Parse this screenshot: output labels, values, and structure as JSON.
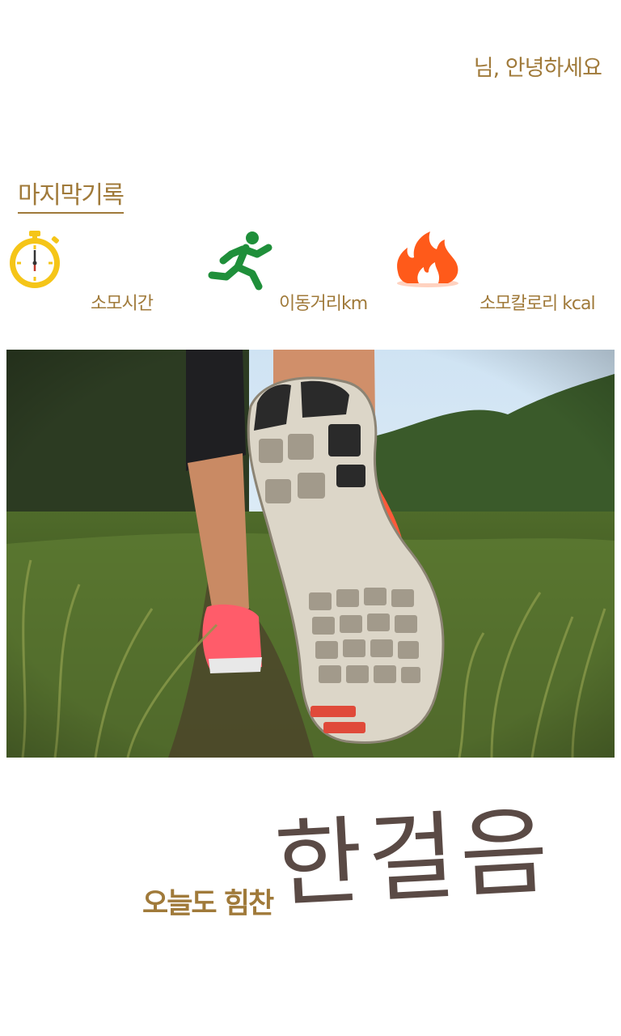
{
  "header": {
    "greeting": "님, 안녕하세요"
  },
  "last_record": {
    "title": "마지막기록",
    "stats": [
      {
        "icon": "stopwatch-icon",
        "label": "소모시간",
        "color": "#f5c518"
      },
      {
        "icon": "runner-icon",
        "label": "이동거리km",
        "color": "#1f8f3a"
      },
      {
        "icon": "fire-icon",
        "label": "소모칼로리 kcal",
        "color": "#ff5a1a"
      }
    ]
  },
  "hero": {
    "image": "running-shoe-sole-photo"
  },
  "motto": {
    "prefix": "오늘도 힘찬",
    "brand": "한걸음"
  },
  "colors": {
    "accent": "#a07a3a",
    "brand_text": "#5a4a45"
  }
}
